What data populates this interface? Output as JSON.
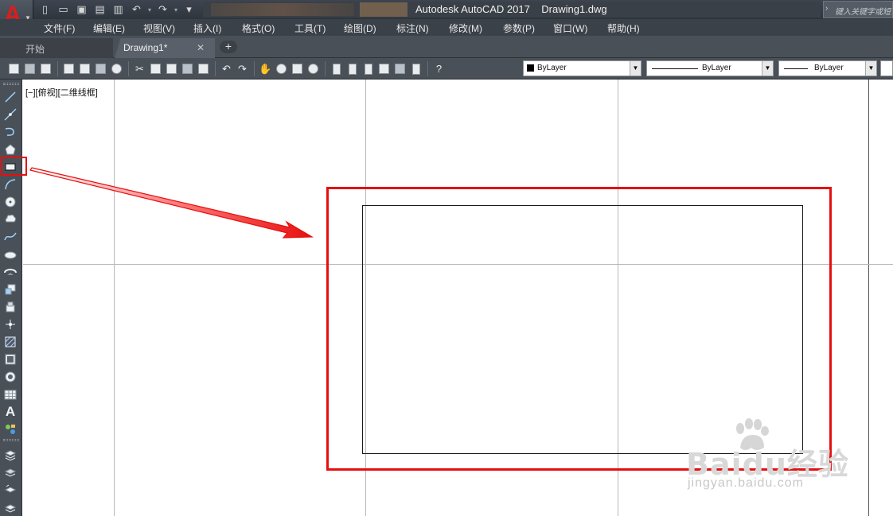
{
  "titlebar": {
    "logo_letter": "A",
    "app_title": "Autodesk AutoCAD 2017    Drawing1.dwg",
    "search_placeholder": "键入关键字或短语",
    "quick_access_icons": [
      "new-icon",
      "open-icon",
      "save-icon",
      "save-as-icon",
      "print-icon",
      "undo-icon",
      "redo-icon",
      "customize-dropdown-icon"
    ]
  },
  "menubar": {
    "items": [
      "文件(F)",
      "编辑(E)",
      "视图(V)",
      "插入(I)",
      "格式(O)",
      "工具(T)",
      "绘图(D)",
      "标注(N)",
      "修改(M)",
      "参数(P)",
      "窗口(W)",
      "帮助(H)"
    ]
  },
  "tabs": {
    "start_label": "开始",
    "drawing_label": "Drawing1*",
    "close_glyph": "✕",
    "add_glyph": "+"
  },
  "properties": {
    "color": "ByLayer",
    "linetype": "ByLayer",
    "lineweight": "ByLayer"
  },
  "draw_toolbar": {
    "tools": [
      "line",
      "construction-line",
      "polyline",
      "polygon",
      "rectangle",
      "arc",
      "circle",
      "revision-cloud",
      "spline",
      "ellipse",
      "ellipse-arc",
      "insert-block",
      "make-block",
      "point",
      "hatch",
      "gradient",
      "region",
      "table",
      "multiline-text",
      "add-selected"
    ],
    "text_tool_glyph": "A",
    "active_tool": "rectangle"
  },
  "canvas": {
    "viewport_label": "[−][俯视][二维线框]"
  },
  "watermark": {
    "main": "Baidu经验",
    "sub": "jingyan.baidu.com"
  },
  "colors": {
    "annotation_red": "#e60f0f",
    "autocad_red": "#d81e1e",
    "toolbar_bg": "#4a5058",
    "menubar_bg": "#3b4149"
  }
}
